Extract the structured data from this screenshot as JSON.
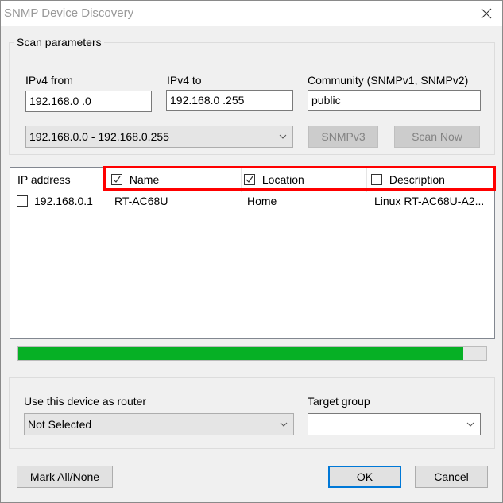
{
  "window": {
    "title": "SNMP Device Discovery",
    "close_icon": "close-icon"
  },
  "scan_parameters": {
    "legend": "Scan parameters",
    "ipv4_from_label": "IPv4 from",
    "ipv4_from_value": "192.168.0  .0",
    "ipv4_to_label": "IPv4 to",
    "ipv4_to_value": "192.168.0  .255",
    "community_label": "Community (SNMPv1, SNMPv2)",
    "community_value": "public",
    "range_select_value": "192.168.0.0 - 192.168.0.255",
    "snmpv3_button": "SNMPv3",
    "scan_now_button": "Scan Now"
  },
  "device_list": {
    "columns": [
      {
        "label": "IP address",
        "has_checkbox": false
      },
      {
        "label": "Name",
        "has_checkbox": true,
        "checked": true
      },
      {
        "label": "Location",
        "has_checkbox": true,
        "checked": true
      },
      {
        "label": "Description",
        "has_checkbox": true,
        "checked": false
      }
    ],
    "rows": [
      {
        "checked": false,
        "ip": "192.168.0.1",
        "name": "RT-AC68U",
        "location": "Home",
        "description": "Linux RT-AC68U-A2..."
      }
    ]
  },
  "progress": {
    "percent": 95,
    "color": "#06b025"
  },
  "router_section": {
    "router_label": "Use this device as router",
    "router_select_value": "Not Selected",
    "target_group_label": "Target group",
    "target_group_value": ""
  },
  "footer": {
    "mark_all_button": "Mark All/None",
    "ok_button": "OK",
    "cancel_button": "Cancel"
  },
  "colors": {
    "highlight": "#ff0000",
    "default_button_border": "#0078d7"
  }
}
